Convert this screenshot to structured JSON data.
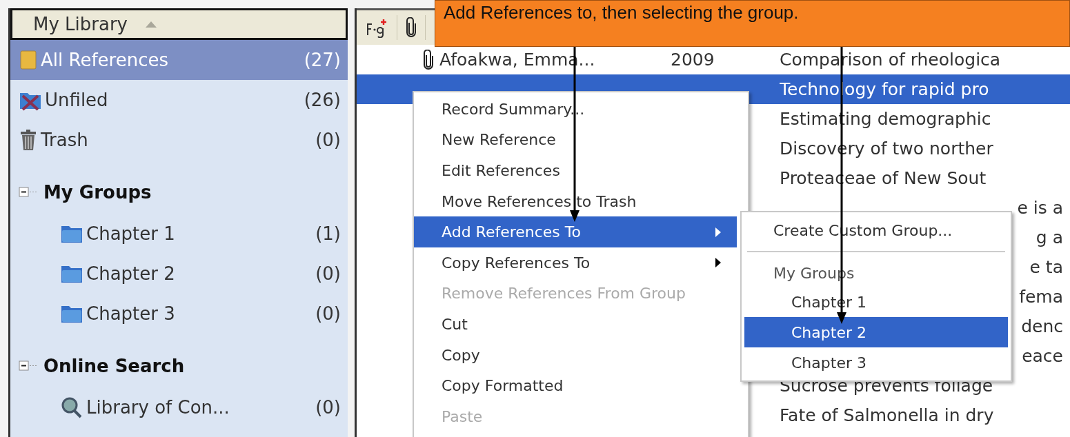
{
  "sidebar": {
    "title": "My Library",
    "items": [
      {
        "kind": "all",
        "label": "All References",
        "count": "(27)",
        "selected": true
      },
      {
        "kind": "unfiled",
        "label": "Unfiled",
        "count": "(26)",
        "selected": false
      },
      {
        "kind": "trash",
        "label": "Trash",
        "count": "(0)",
        "selected": false
      },
      {
        "kind": "section",
        "label": "My Groups",
        "expanded": true,
        "selected": false,
        "children": [
          {
            "kind": "group",
            "label": "Chapter 1",
            "count": "(1)",
            "selected": false
          },
          {
            "kind": "group",
            "label": "Chapter 2",
            "count": "(0)",
            "selected": false
          },
          {
            "kind": "group",
            "label": "Chapter 3",
            "count": "(0)",
            "selected": false
          }
        ]
      },
      {
        "kind": "section",
        "label": "Online Search",
        "expanded": true,
        "selected": false,
        "children": [
          {
            "kind": "search",
            "label": "Library of Con...",
            "count": "(0)",
            "selected": false
          }
        ]
      }
    ]
  },
  "reference_list": {
    "rows": [
      {
        "attachment": true,
        "author": "Afoakwa, Emma...",
        "year": "2009",
        "title": "Comparison of rheologica",
        "selected": false,
        "covered": false
      },
      {
        "title": "Technology for rapid pro",
        "selected": true,
        "covered": false
      },
      {
        "title": "Estimating demographic",
        "selected": false,
        "covered": false
      },
      {
        "title": "Discovery of two norther",
        "selected": false,
        "covered": false
      },
      {
        "title": "Proteaceae of New Sout",
        "selected": false,
        "covered": false
      },
      {
        "title": "e is a",
        "selected": false,
        "covered": true
      },
      {
        "title": "g a",
        "selected": false,
        "covered": true
      },
      {
        "title": "e ta",
        "selected": false,
        "covered": true
      },
      {
        "title": "fema",
        "selected": false,
        "covered": true
      },
      {
        "title": "denc",
        "selected": false,
        "covered": true
      },
      {
        "title": "eace",
        "selected": false,
        "covered": true
      },
      {
        "title": "Sucrose prevents foliage",
        "selected": false,
        "covered": false
      },
      {
        "title": "Fate of Salmonella in dry",
        "selected": false,
        "covered": false
      }
    ]
  },
  "context_menu": {
    "items": [
      {
        "label": "Record Summary...",
        "selected": false,
        "disabled": false,
        "submenu": false
      },
      {
        "label": "New Reference",
        "selected": false,
        "disabled": false,
        "submenu": false
      },
      {
        "label": "Edit References",
        "selected": false,
        "disabled": false,
        "submenu": false
      },
      {
        "label": "Move References to Trash",
        "selected": false,
        "disabled": false,
        "submenu": false
      },
      {
        "label": "Add References To",
        "selected": true,
        "disabled": false,
        "submenu": true
      },
      {
        "label": "Copy References To",
        "selected": false,
        "disabled": false,
        "submenu": true
      },
      {
        "label": "Remove References From Group",
        "selected": false,
        "disabled": true,
        "submenu": false
      },
      {
        "label": "Cut",
        "selected": false,
        "disabled": false,
        "submenu": false
      },
      {
        "label": "Copy",
        "selected": false,
        "disabled": false,
        "submenu": false
      },
      {
        "label": "Copy Formatted",
        "selected": false,
        "disabled": false,
        "submenu": false
      },
      {
        "label": "Paste",
        "selected": false,
        "disabled": true,
        "submenu": false
      }
    ]
  },
  "submenu": {
    "items": [
      {
        "kind": "command",
        "label": "Create Custom Group...",
        "selected": false
      },
      {
        "kind": "separator"
      },
      {
        "kind": "header",
        "label": "My Groups"
      },
      {
        "kind": "group",
        "label": "Chapter 1",
        "selected": false
      },
      {
        "kind": "group",
        "label": "Chapter 2",
        "selected": true
      },
      {
        "kind": "group",
        "label": "Chapter 3",
        "selected": false
      }
    ]
  },
  "callout": {
    "text": "Add References to, then selecting the group."
  }
}
